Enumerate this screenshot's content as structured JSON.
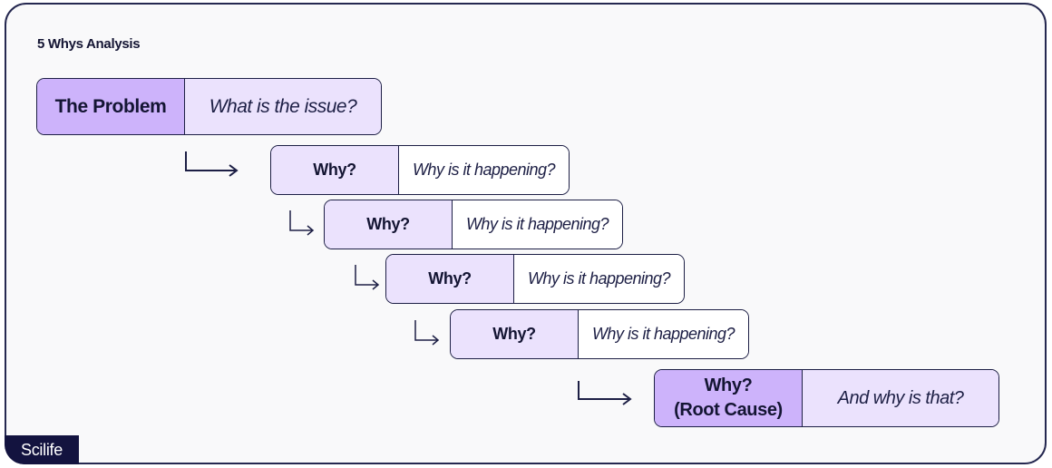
{
  "title": "5 Whys Analysis",
  "colors": {
    "primary_fill": "#cdb3fb",
    "secondary_fill": "#ebe2fd",
    "white_fill": "#ffffff",
    "outline": "#1d1f45",
    "brand_bg": "#13133f"
  },
  "problem": {
    "label": "The Problem",
    "question": "What is the issue?"
  },
  "whys": [
    {
      "label": "Why?",
      "question": "Why is it happening?"
    },
    {
      "label": "Why?",
      "question": "Why is it happening?"
    },
    {
      "label": "Why?",
      "question": "Why is it happening?"
    },
    {
      "label": "Why?",
      "question": "Why is it happening?"
    }
  ],
  "root_cause": {
    "label_line1": "Why?",
    "label_line2": "(Root Cause)",
    "question": "And why is that?"
  },
  "brand": "Scilife"
}
